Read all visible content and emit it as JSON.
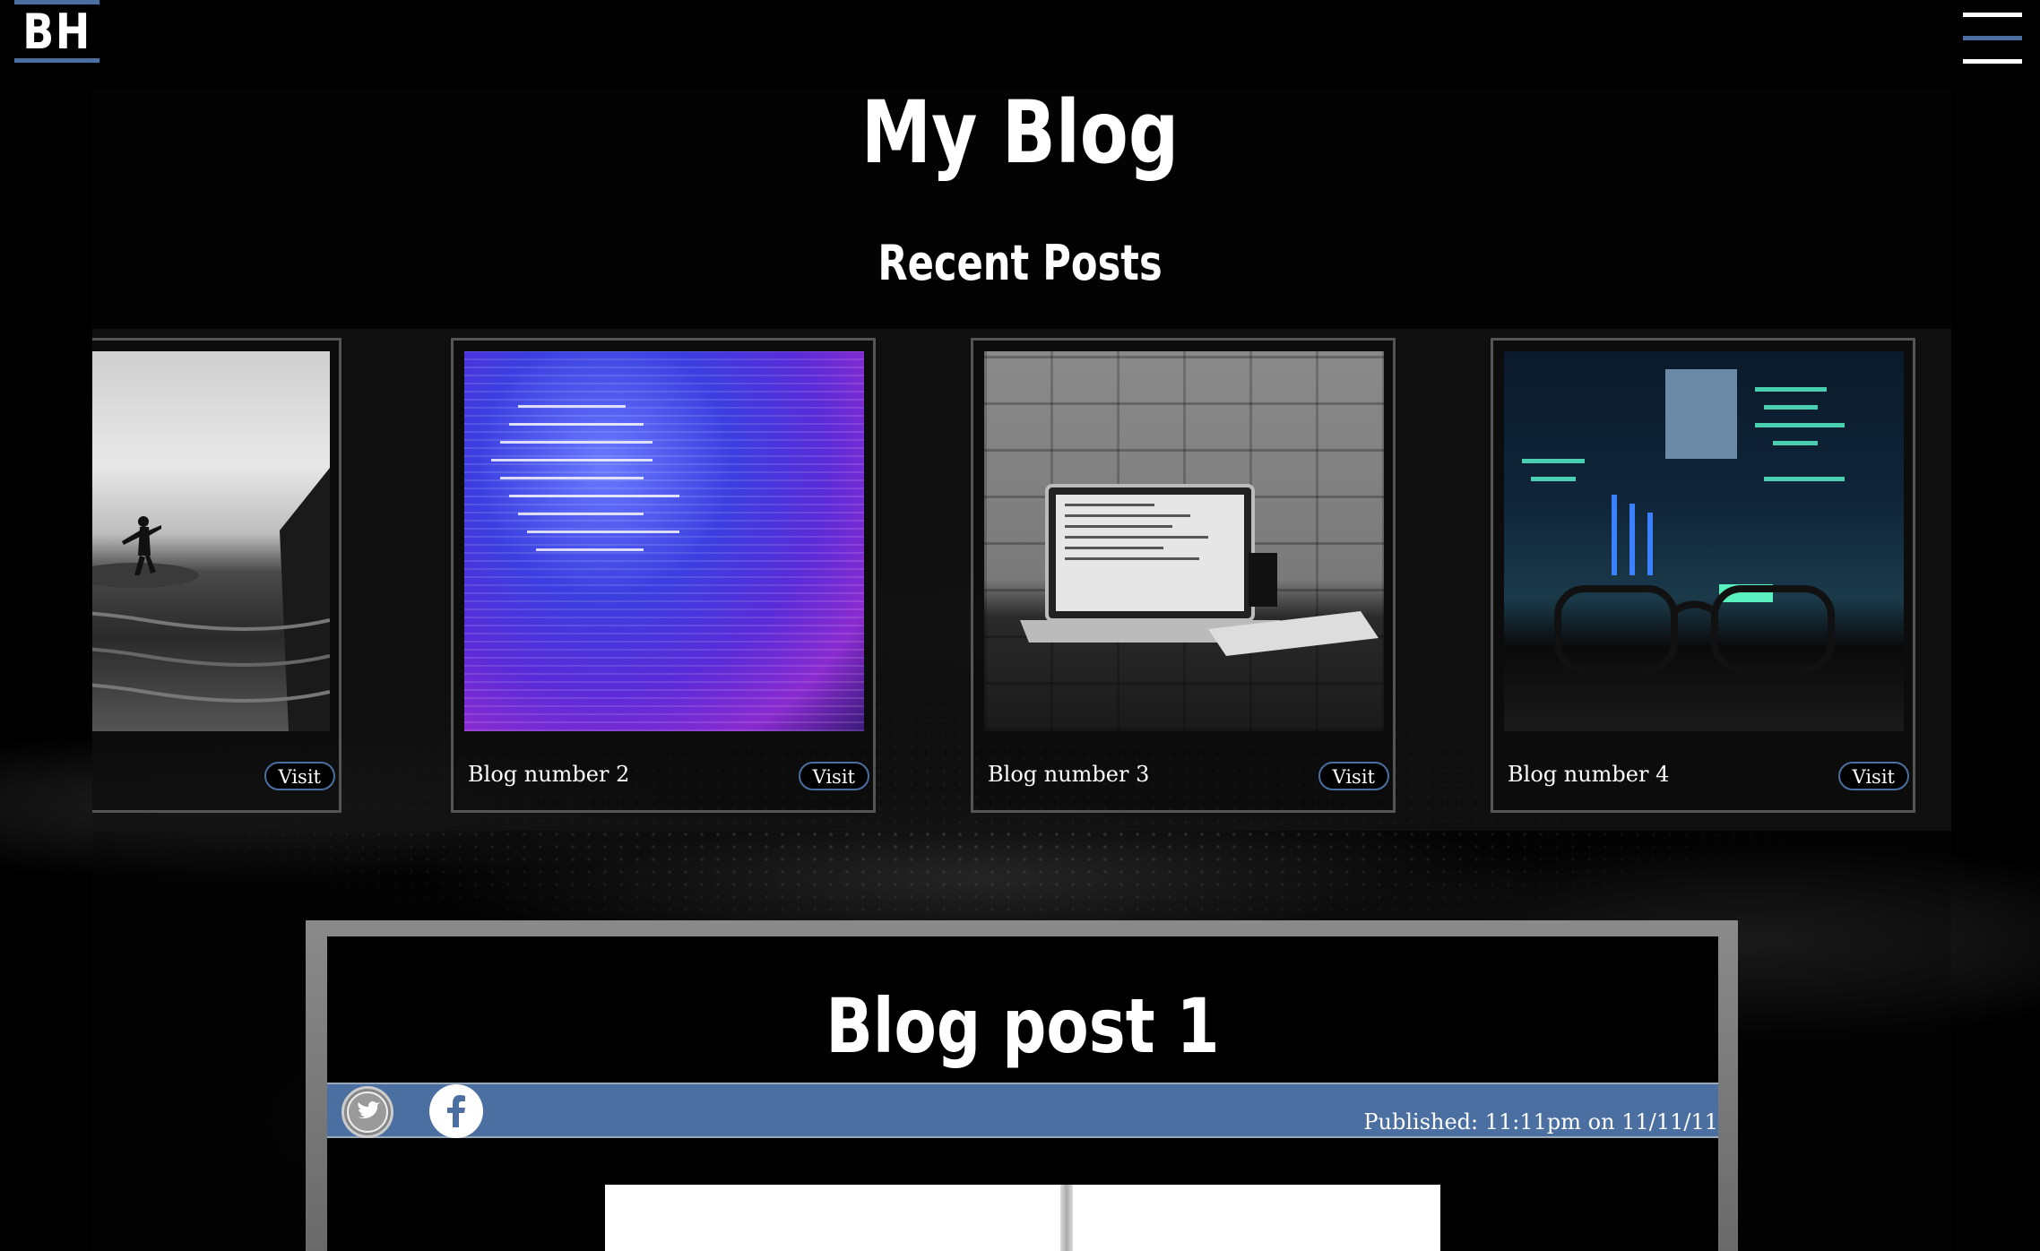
{
  "header": {
    "logo_text": "BH",
    "menu_icon": "hamburger-menu-icon",
    "accent_color": "#4a6fa0"
  },
  "page": {
    "title": "My Blog",
    "recent_heading": "Recent Posts"
  },
  "carousel": {
    "cards": [
      {
        "label": "",
        "visit_label": "Visit",
        "image": "surfer-photo"
      },
      {
        "label": "Blog number 2",
        "visit_label": "Visit",
        "image": "code-screen-photo"
      },
      {
        "label": "Blog number 3",
        "visit_label": "Visit",
        "image": "laptop-desk-photo"
      },
      {
        "label": "Blog number 4",
        "visit_label": "Visit",
        "image": "glasses-monitor-photo"
      }
    ]
  },
  "post": {
    "title": "Blog post 1",
    "published": "Published: 11:11pm on 11/11/11",
    "share_icons": [
      "twitter-icon",
      "facebook-icon"
    ]
  }
}
